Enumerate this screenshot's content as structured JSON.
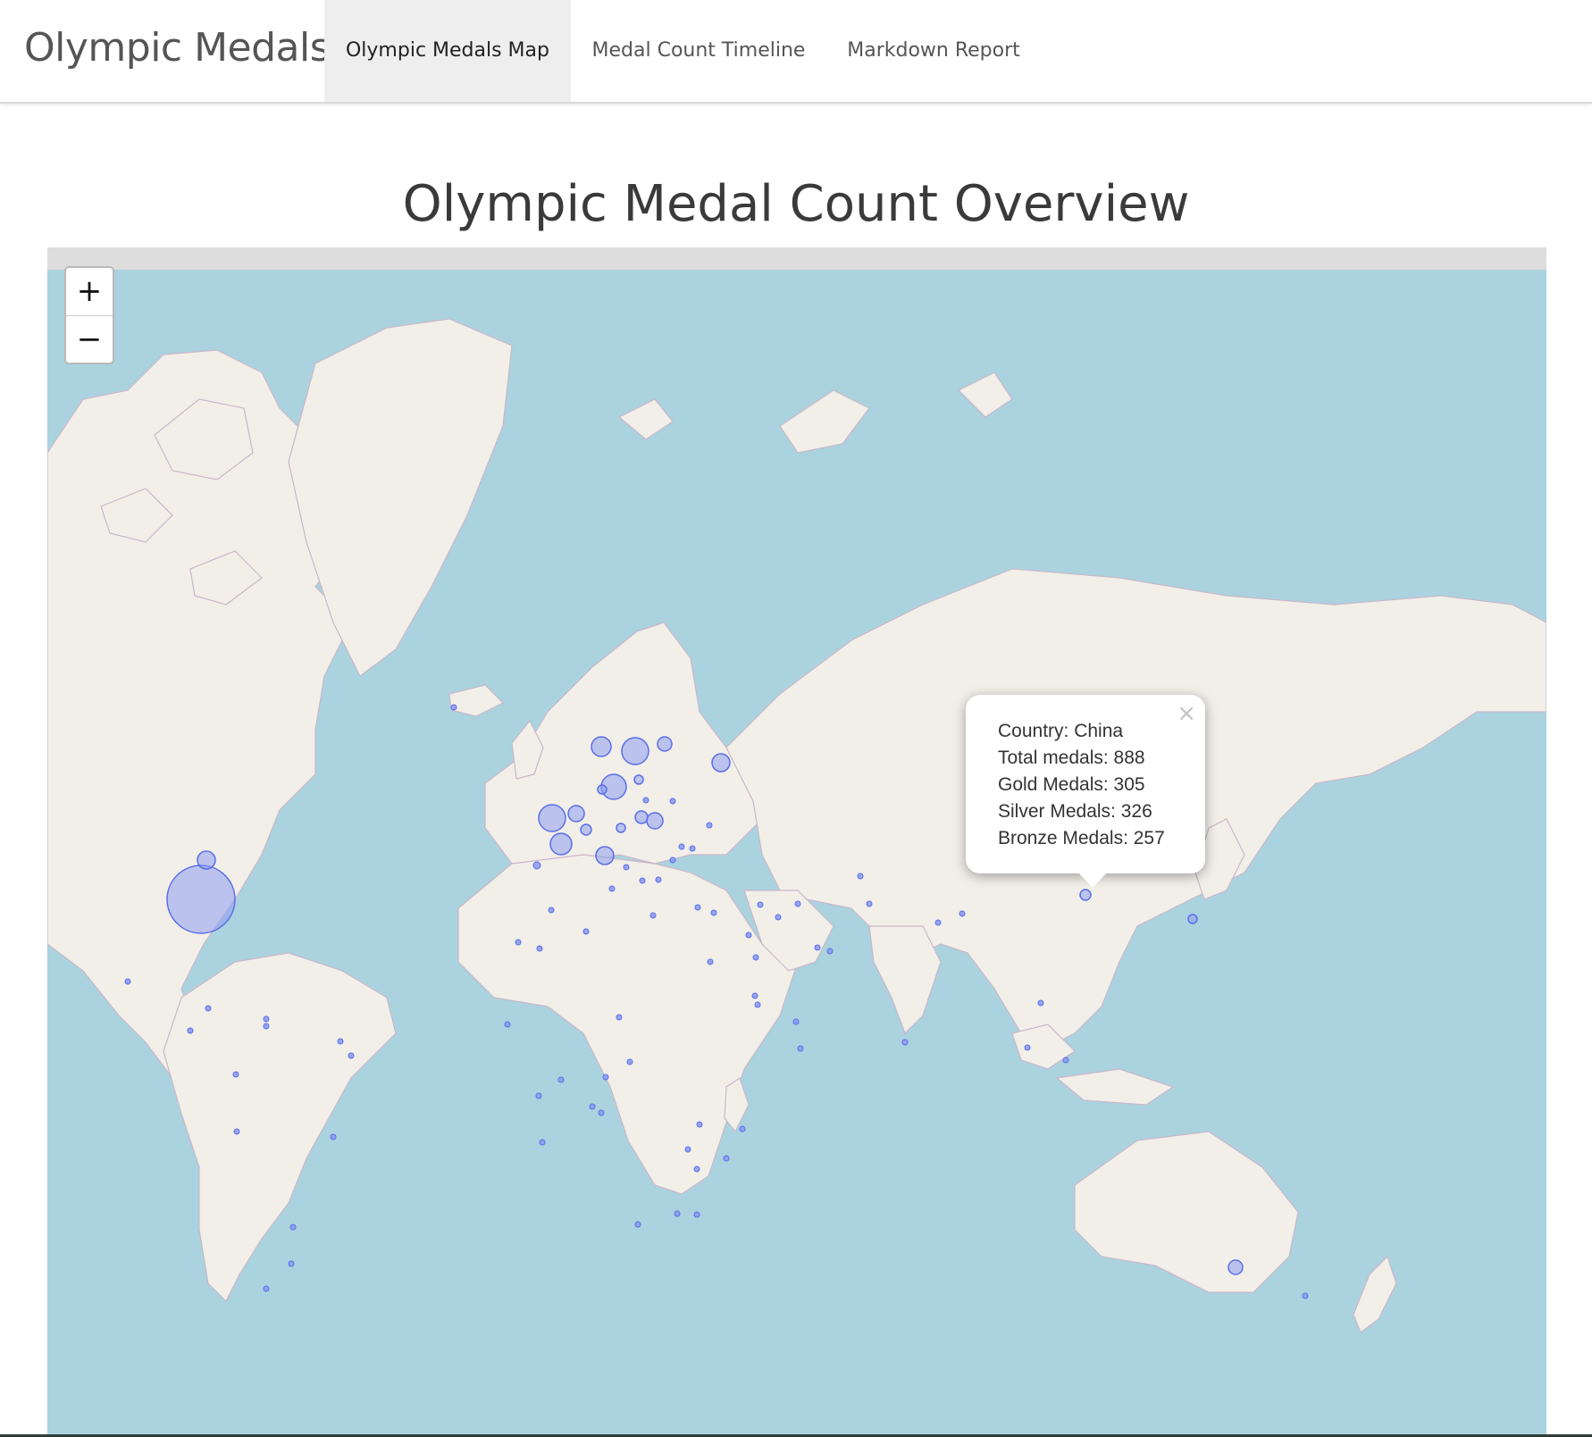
{
  "app": {
    "brand": "Olympic Medals",
    "tabs": [
      {
        "label": "Olympic Medals Map",
        "active": true
      },
      {
        "label": "Medal Count Timeline",
        "active": false
      },
      {
        "label": "Markdown Report",
        "active": false
      }
    ]
  },
  "page": {
    "title": "Olympic Medal Count Overview"
  },
  "map": {
    "zoom_in_label": "+",
    "zoom_out_label": "−",
    "colors": {
      "water": "#aad3df",
      "land": "#f2efe9",
      "border": "#c9b7c9",
      "marker_fill": "#8c9cf0",
      "marker_stroke": "#5a6ee8"
    },
    "popup": {
      "close_label": "×",
      "lines": [
        "Country: China",
        "Total medals: 888",
        "Gold Medals: 305",
        "Silver Medals: 326",
        "Bronze Medals: 257"
      ]
    }
  }
}
